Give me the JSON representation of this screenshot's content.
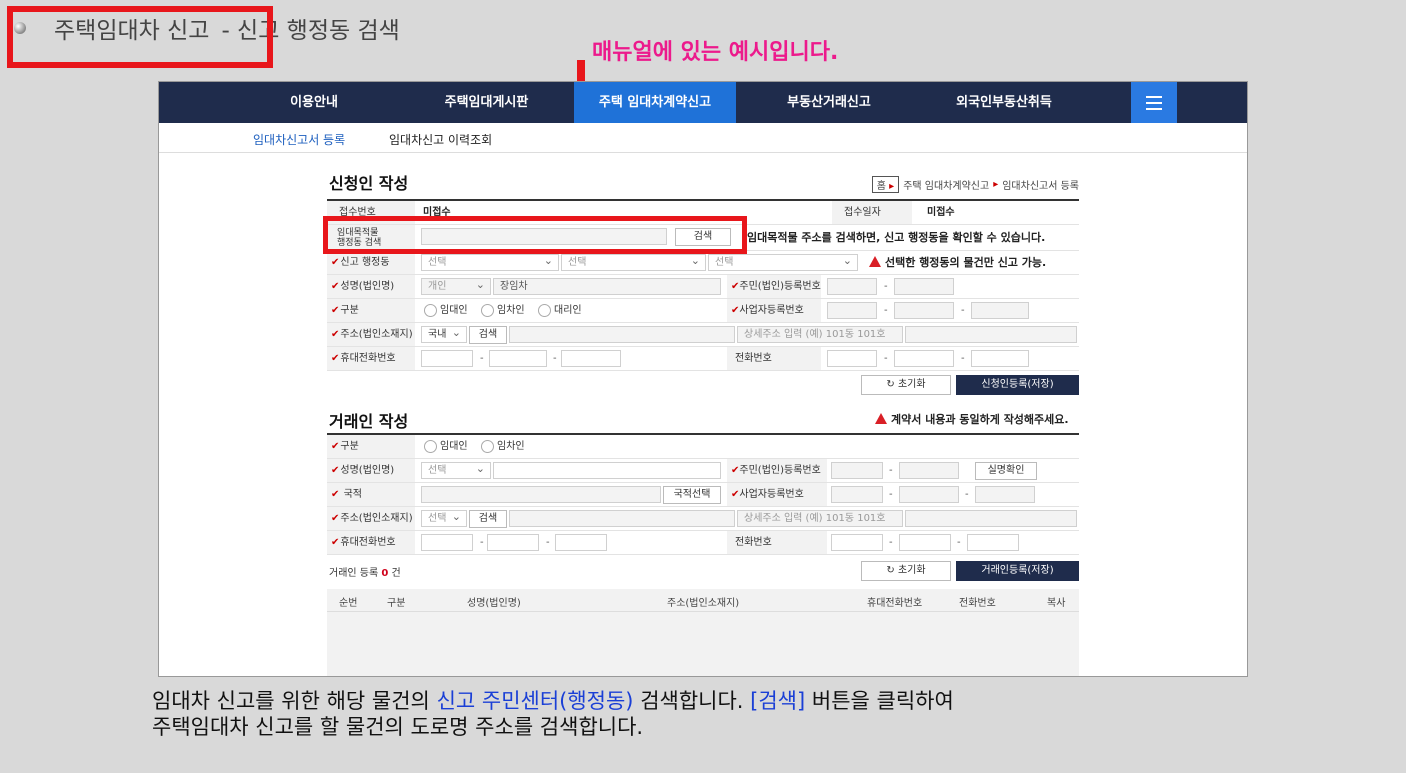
{
  "slide": {
    "title_main": "주택임대차 신고",
    "title_sub": "- 신고 행정동 검색",
    "manual_note": "매뉴얼에 있는 예시입니다."
  },
  "gnb": {
    "items": [
      "이용안내",
      "주택임대게시판",
      "주택 임대차계약신고",
      "부동산거래신고",
      "외국인부동산취득"
    ],
    "active_index": 2
  },
  "subnav": {
    "items": [
      "임대차신고서 등록",
      "임대차신고 이력조회"
    ]
  },
  "applicant": {
    "title": "신청인 작성",
    "breadcrumb": {
      "home": "홈",
      "path1": "주택 임대차계약신고",
      "path2": "임대차신고서 등록"
    },
    "receipt_no_label": "접수번호",
    "receipt_no_value": "미접수",
    "receipt_date_label": "접수일자",
    "receipt_date_value": "미접수",
    "search_label_1": "임대목적물",
    "search_label_2": "행정동 검색",
    "search_button": "검색",
    "search_help": "임대목적물 주소를 검색하면, 신고 행정동을 확인할 수 있습니다.",
    "report_dong_label": "신고 행정동",
    "select_placeholder": "선택",
    "report_dong_warning": "선택한 행정동의 물건만 신고 가능.",
    "name_label": "성명(법인명)",
    "name_type": "개인",
    "name_value": "장임차",
    "resident_no_label": "주민(법인)등록번호",
    "category_label": "구분",
    "category_options": [
      "임대인",
      "임차인",
      "대리인"
    ],
    "biz_no_label": "사업자등록번호",
    "address_label": "주소(법인소재지)",
    "address_country": "국내",
    "address_search": "검색",
    "address_detail_placeholder": "상세주소 입력 (예) 101동 101호",
    "mobile_label": "휴대전화번호",
    "phone_label": "전화번호",
    "reset_button": "초기화",
    "save_button": "신청인등록(저장)"
  },
  "counterparty": {
    "title": "거래인 작성",
    "warning": "계약서 내용과 동일하게 작성해주세요.",
    "category_label": "구분",
    "category_options": [
      "임대인",
      "임차인"
    ],
    "name_label": "성명(법인명)",
    "name_type": "선택",
    "resident_no_label": "주민(법인)등록번호",
    "verify_button": "실명확인",
    "nationality_label": "국적",
    "nationality_button": "국적선택",
    "biz_no_label": "사업자등록번호",
    "address_label": "주소(법인소재지)",
    "address_type": "선택",
    "address_search": "검색",
    "address_detail_placeholder": "상세주소 입력 (예) 101동 101호",
    "mobile_label": "휴대전화번호",
    "phone_label": "전화번호",
    "count_prefix": "거래인 등록",
    "count_value": "0",
    "count_suffix": "건",
    "reset_button": "초기화",
    "save_button": "거래인등록(저장)",
    "columns": [
      "순번",
      "구분",
      "성명(법인명)",
      "주소(법인소재지)",
      "휴대전화번호",
      "전화번호",
      "복사"
    ]
  },
  "caption": {
    "line1_a": "임대차 신고를 위한 해당 물건의",
    "line1_b": "신고 주민센터(행정동)",
    "line1_c": "검색합니다.",
    "line1_d": "[검색]",
    "line1_e": "버튼을 클릭하여",
    "line2": "주택임대차 신고를 할 물건의 도로명 주소를 검색합니다."
  }
}
